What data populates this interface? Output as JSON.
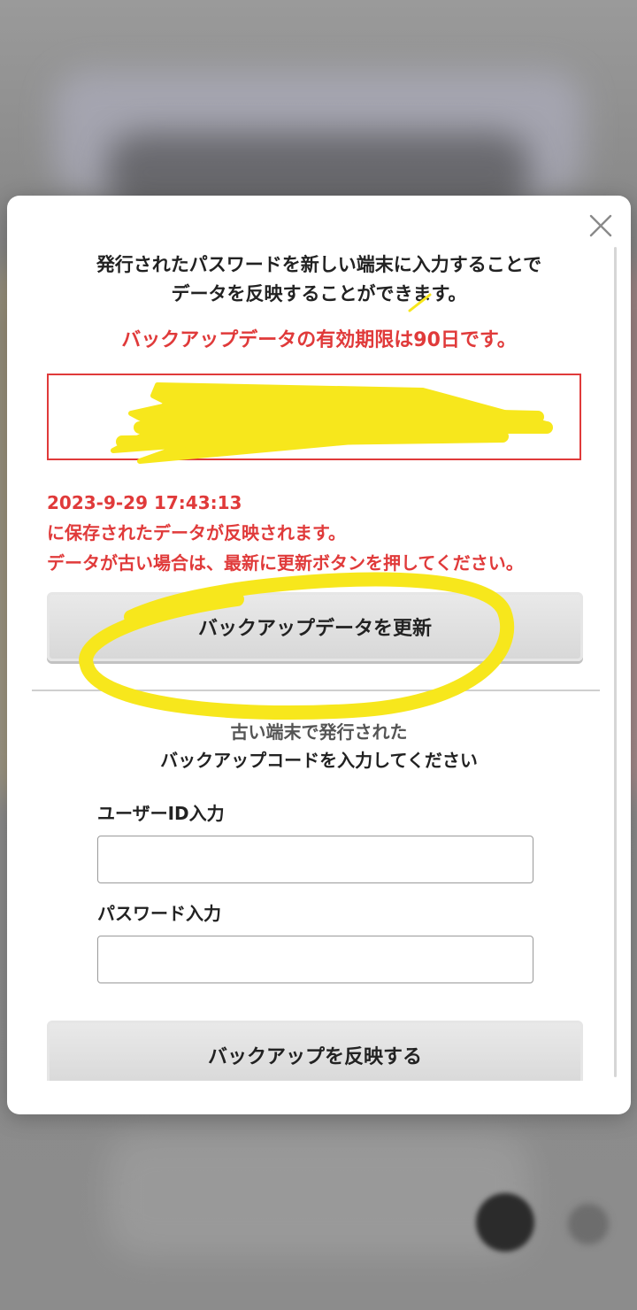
{
  "modal": {
    "intro_line1": "発行されたパスワードを新しい端末に入力することで",
    "intro_line2": "データを反映することができます。",
    "expiry_notice": "バックアップデータの有効期限は90日です。",
    "password_box_text": "",
    "saved_datetime": "2023-9-29 17:43:13",
    "saved_line2": "に保存されたデータが反映されます。",
    "saved_line3": "データが古い場合は、最新に更新ボタンを押してください。",
    "update_button_label": "バックアップデータを更新",
    "restore_desc_line1": "古い端末で発行された",
    "restore_desc_line2": "バックアップコードを入力してください",
    "user_id_label": "ユーザーID入力",
    "user_id_value": "",
    "password_label": "パスワード入力",
    "password_value": "",
    "restore_button_label": "バックアップを反映する"
  },
  "colors": {
    "accent_red": "#e03a3a",
    "highlight_yellow": "#f7e71c",
    "button_gray": "#dedede"
  },
  "icons": {
    "close": "close-icon"
  }
}
